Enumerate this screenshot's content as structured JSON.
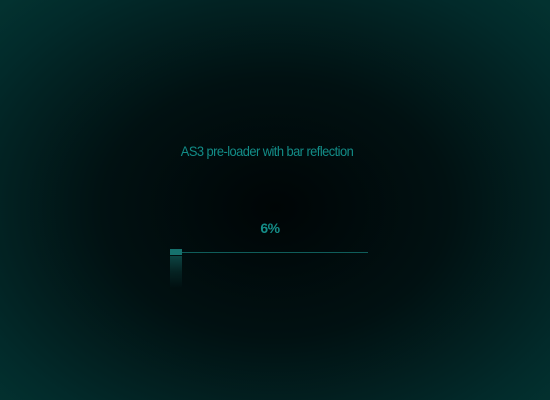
{
  "preloader": {
    "title": "AS3 pre-loader with bar reflection",
    "percent_label": "6%",
    "progress_fraction": 0.06
  },
  "colors": {
    "text": "#128d88",
    "bar_fill": "#16716d",
    "bar_track": "#0f5d5a",
    "background_edge": "#033230",
    "background_center": "#000506"
  }
}
